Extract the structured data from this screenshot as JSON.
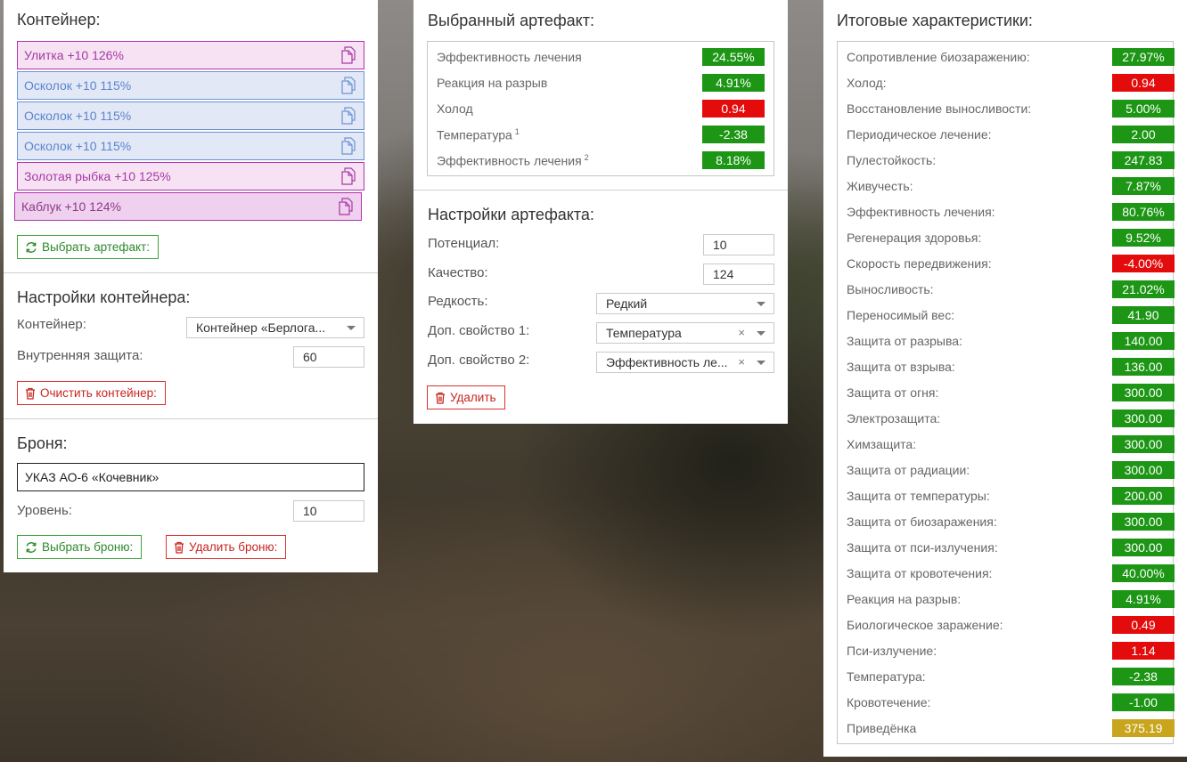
{
  "container_panel": {
    "title": "Контейнер:",
    "artifacts": [
      {
        "label": "Улитка +10 126%",
        "style": "purple"
      },
      {
        "label": "Осколок +10 115%",
        "style": "blue"
      },
      {
        "label": "Осколок +10 115%",
        "style": "blue"
      },
      {
        "label": "Осколок +10 115%",
        "style": "blue"
      },
      {
        "label": "Золотая рыбка +10 125%",
        "style": "purple"
      },
      {
        "label": "Каблук +10 124%",
        "style": "purple-dark"
      }
    ],
    "select_artifact_button": "Выбрать артефакт:"
  },
  "container_settings": {
    "title": "Настройки контейнера:",
    "container_label": "Контейнер:",
    "container_value": "Контейнер «Берлога...",
    "inner_protection_label": "Внутренняя защита:",
    "inner_protection_value": "60",
    "clear_button": "Очистить контейнер:"
  },
  "armor": {
    "title": "Броня:",
    "name": "УКАЗ АО-6 «Кочевник»",
    "level_label": "Уровень:",
    "level_value": "10",
    "select_button": "Выбрать броню:",
    "delete_button": "Удалить броню:"
  },
  "selected_artifact": {
    "title": "Выбранный артефакт:",
    "stats": [
      {
        "name": "Эффективность лечения",
        "sup": "",
        "value": "24.55%",
        "color": "green"
      },
      {
        "name": "Реакция на разрыв",
        "sup": "",
        "value": "4.91%",
        "color": "green"
      },
      {
        "name": "Холод",
        "sup": "",
        "value": "0.94",
        "color": "red"
      },
      {
        "name": "Температура",
        "sup": "1",
        "value": "-2.38",
        "color": "green"
      },
      {
        "name": "Эффективность лечения",
        "sup": "2",
        "value": "8.18%",
        "color": "green"
      }
    ]
  },
  "artifact_settings": {
    "title": "Настройки артефакта:",
    "potential_label": "Потенциал:",
    "potential_value": "10",
    "quality_label": "Качество:",
    "quality_value": "124",
    "rarity_label": "Редкость:",
    "rarity_value": "Редкий",
    "extra1_label": "Доп. свойство 1:",
    "extra1_value": "Температура",
    "extra2_label": "Доп. свойство 2:",
    "extra2_value": "Эффективность ле...",
    "clear_symbol": "×",
    "delete_button": "Удалить"
  },
  "totals": {
    "title": "Итоговые характеристики:",
    "stats": [
      {
        "name": "Сопротивление биозаражению:",
        "value": "27.97%",
        "color": "green"
      },
      {
        "name": "Холод:",
        "value": "0.94",
        "color": "red"
      },
      {
        "name": "Восстановление выносливости:",
        "value": "5.00%",
        "color": "green"
      },
      {
        "name": "Периодическое лечение:",
        "value": "2.00",
        "color": "green"
      },
      {
        "name": "Пулестойкость:",
        "value": "247.83",
        "color": "green"
      },
      {
        "name": "Живучесть:",
        "value": "7.87%",
        "color": "green"
      },
      {
        "name": "Эффективность лечения:",
        "value": "80.76%",
        "color": "green"
      },
      {
        "name": "Регенерация здоровья:",
        "value": "9.52%",
        "color": "green"
      },
      {
        "name": "Скорость передвижения:",
        "value": "-4.00%",
        "color": "red"
      },
      {
        "name": "Выносливость:",
        "value": "21.02%",
        "color": "green"
      },
      {
        "name": "Переносимый вес:",
        "value": "41.90",
        "color": "green"
      },
      {
        "name": "Защита от разрыва:",
        "value": "140.00",
        "color": "green"
      },
      {
        "name": "Защита от взрыва:",
        "value": "136.00",
        "color": "green"
      },
      {
        "name": "Защита от огня:",
        "value": "300.00",
        "color": "green"
      },
      {
        "name": "Электрозащита:",
        "value": "300.00",
        "color": "green"
      },
      {
        "name": "Химзащита:",
        "value": "300.00",
        "color": "green"
      },
      {
        "name": "Защита от радиации:",
        "value": "300.00",
        "color": "green"
      },
      {
        "name": "Защита от температуры:",
        "value": "200.00",
        "color": "green"
      },
      {
        "name": "Защита от биозаражения:",
        "value": "300.00",
        "color": "green"
      },
      {
        "name": "Защита от пси-излучения:",
        "value": "300.00",
        "color": "green"
      },
      {
        "name": "Защита от кровотечения:",
        "value": "40.00%",
        "color": "green"
      },
      {
        "name": "Реакция на разрыв:",
        "value": "4.91%",
        "color": "green"
      },
      {
        "name": "Биологическое заражение:",
        "value": "0.49",
        "color": "red"
      },
      {
        "name": "Пси-излучение:",
        "value": "1.14",
        "color": "red"
      },
      {
        "name": "Температура:",
        "value": "-2.38",
        "color": "green"
      },
      {
        "name": "Кровотечение:",
        "value": "-1.00",
        "color": "green"
      },
      {
        "name": "Приведёнка",
        "value": "375.19",
        "color": "gold"
      }
    ]
  },
  "colors": {
    "green": "#1c9614",
    "red": "#e30b0b",
    "gold": "#c9a41d"
  }
}
